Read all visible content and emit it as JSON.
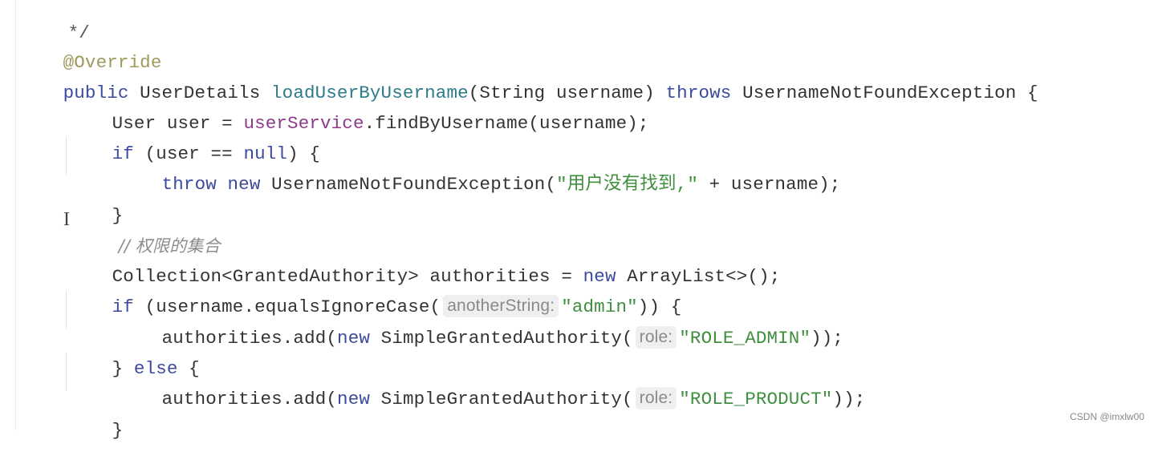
{
  "colors": {
    "keyword": "#3b4a9c",
    "annotation": "#9e9a5a",
    "method": "#2c7a8a",
    "field": "#8e3a8c",
    "string": "#3f8f3f",
    "comment": "#8c8c8c",
    "text": "#333333",
    "hint_background": "#efefef"
  },
  "code": {
    "l0": "*/",
    "l1": {
      "annotation": "@Override"
    },
    "l2": {
      "kw_public": "public",
      "type": " UserDetails ",
      "method": "loadUserByUsername",
      "params": "(String username) ",
      "kw_throws": "throws",
      "rest": " UsernameNotFoundException {"
    },
    "l3": {
      "pre": "User user = ",
      "field": "userService",
      "post": ".findByUsername(username);"
    },
    "l4": {
      "kw_if": "if",
      "mid": " (user == ",
      "kw_null": "null",
      "post": ") {"
    },
    "l5": {
      "kw_throw": "throw",
      "sp": " ",
      "kw_new": "new",
      "mid": " UsernameNotFoundException(",
      "str": "\"用户没有找到,\"",
      "post": " + username);"
    },
    "l6": "}",
    "l7": {
      "comment": "// 权限的集合"
    },
    "l8": {
      "pre": "Collection<GrantedAuthority> authorities = ",
      "kw_new": "new",
      "post": " ArrayList<>();"
    },
    "l9": {
      "kw_if": "if",
      "pre": " (username.equalsIgnoreCase(",
      "hint": "anotherString:",
      "str": "\"admin\"",
      "post": ")) {"
    },
    "l10": {
      "pre": "authorities.add(",
      "kw_new": "new",
      "mid": " SimpleGrantedAuthority(",
      "hint": "role:",
      "str": "\"ROLE_ADMIN\"",
      "post": "));"
    },
    "l11": {
      "pre": "} ",
      "kw_else": "else",
      "post": " {"
    },
    "l12": {
      "pre": "authorities.add(",
      "kw_new": "new",
      "mid": " SimpleGrantedAuthority(",
      "hint": "role:",
      "str": "\"ROLE_PRODUCT\"",
      "post": "));"
    },
    "l13": "}"
  },
  "cursor_glyph": "I",
  "watermark": "CSDN @imxlw00"
}
